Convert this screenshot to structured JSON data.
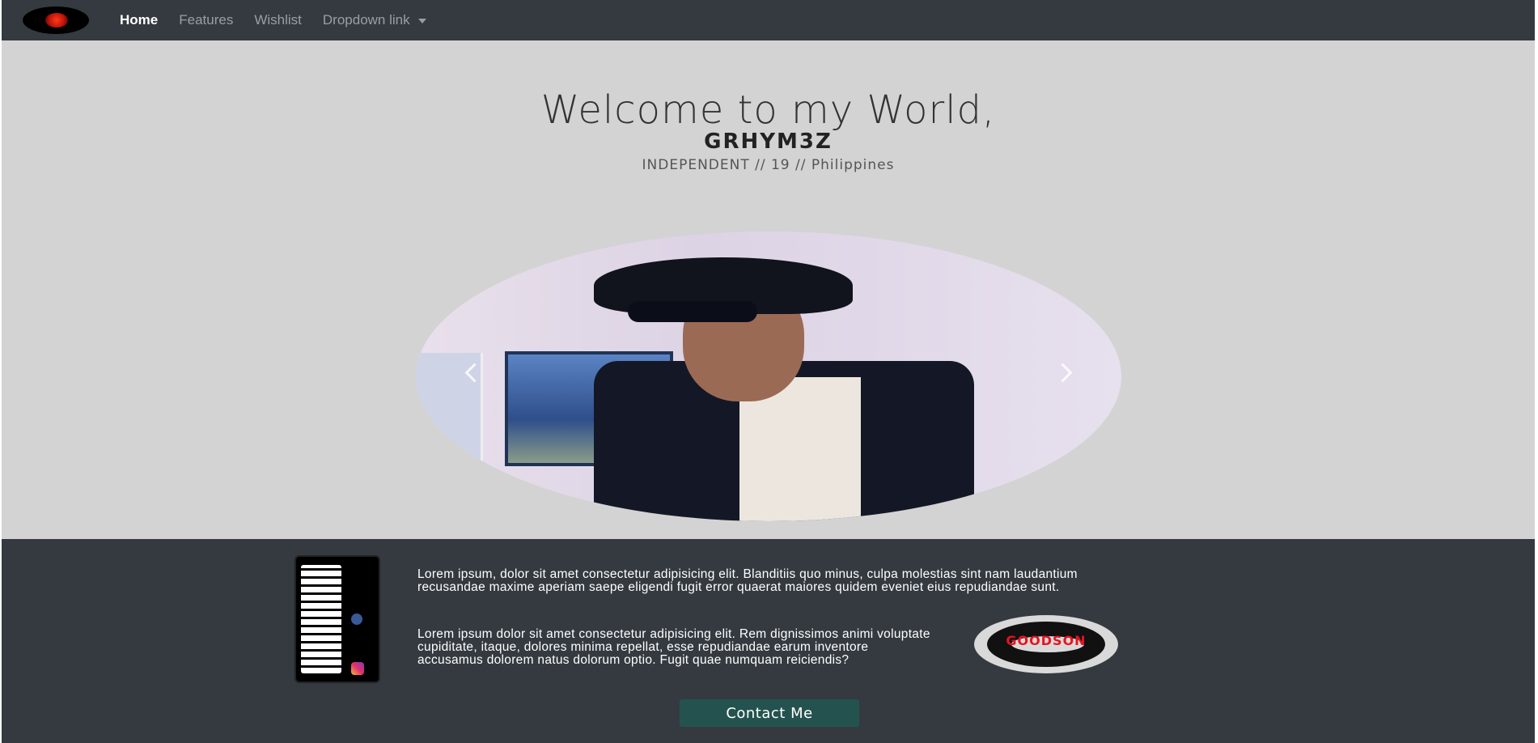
{
  "navbar": {
    "brand_icon": "brand-logo-icon",
    "items": [
      {
        "label": "Home",
        "active": true
      },
      {
        "label": "Features",
        "active": false
      },
      {
        "label": "Wishlist",
        "active": false
      },
      {
        "label": "Dropdown link",
        "active": false,
        "dropdown": true
      }
    ]
  },
  "hero": {
    "title": "Welcome to my World,",
    "name": "GRHYM3Z",
    "tagline": "INDEPENDENT // 19 // Philippines"
  },
  "carousel": {
    "prev_icon": "chevron-left-icon",
    "next_icon": "chevron-right-icon"
  },
  "footer": {
    "card": {
      "handle_ig": "@grhym3z",
      "handle_fb": "GRHYM3Z"
    },
    "paragraph_1": "Lorem ipsum, dolor sit amet consectetur adipisicing elit. Blanditiis quo minus, culpa molestias sint nam laudantium recusandae maxime aperiam saepe eligendi fugit error quaerat maiores quidem eveniet eius repudiandae sunt.",
    "paragraph_2": "Lorem ipsum dolor sit amet consectetur adipisicing elit. Rem dignissimos animi voluptate cupiditate, itaque, dolores minima repellat, esse repudiandae earum inventore accusamus dolorem natus dolorum optio. Fugit quae numquam reiciendis?",
    "logo_text": "GOODSON",
    "contact_label": "Contact Me"
  },
  "colors": {
    "navbar_bg": "#343a40",
    "page_bg": "#d3d3d3",
    "contact_button": "#24534f",
    "logo_red": "#e5141f"
  }
}
